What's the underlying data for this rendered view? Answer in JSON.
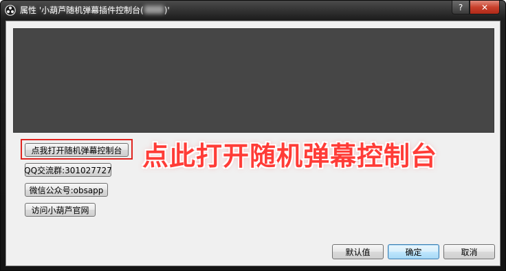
{
  "window": {
    "title_prefix": "属性 '小葫芦随机弹幕插件控制台(",
    "title_suffix": ")'",
    "help_glyph": "?",
    "close_glyph": "✕",
    "app_icon": "obs-icon"
  },
  "panel": {
    "open_console_button": "点我打开随机弹幕控制台",
    "qq_group_button": "QQ交流群:301027727",
    "wechat_button": "微信公众号:obsapp",
    "website_button": "访问小葫芦官网"
  },
  "annotation": {
    "text": "点此打开随机弹幕控制台",
    "color": "#ff3c37"
  },
  "footer": {
    "default_button": "默认值",
    "ok_button": "确定",
    "cancel_button": "取消"
  },
  "colors": {
    "preview_bg": "#464646",
    "highlight_border": "#e0241f",
    "close_button": "#c8402c"
  }
}
